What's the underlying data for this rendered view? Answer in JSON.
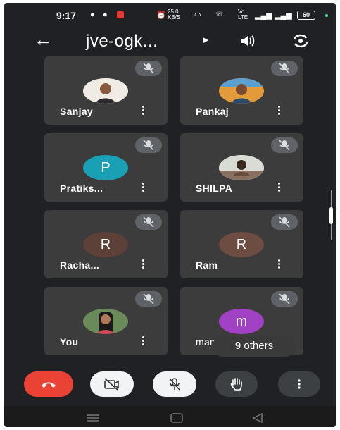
{
  "status_bar": {
    "time": "9:17",
    "net_speed": "25.0\nKB/S",
    "battery": "60",
    "signal_text": "Vo LTE"
  },
  "header": {
    "title": "jve-ogk...",
    "back_icon": "arrow-left-icon",
    "speaker_icon": "speaker-icon",
    "camera_switch_icon": "camera-switch-icon"
  },
  "participants": [
    {
      "name": "Sanjay",
      "avatar": "photo",
      "muted": true
    },
    {
      "name": "Pankaj",
      "avatar": "photo",
      "muted": true
    },
    {
      "name": "Pratiks...",
      "avatar_letter": "P",
      "avatar_color": "#1aa0b5",
      "muted": true
    },
    {
      "name": "SHILPA",
      "avatar": "photo",
      "muted": true
    },
    {
      "name": "Racha...",
      "avatar_letter": "R",
      "avatar_color": "#6d4c41",
      "muted": true
    },
    {
      "name": "Ram",
      "avatar_letter": "R",
      "avatar_color": "#7a5548",
      "muted": true
    },
    {
      "name": "You",
      "avatar": "photo",
      "muted": true
    },
    {
      "name": "man",
      "avatar_letter": "m",
      "avatar_color": "#a142c4",
      "muted": true
    }
  ],
  "others_chip": "9 others",
  "controls": {
    "end_call_color": "#ea4335",
    "items": [
      "end-call-icon",
      "camera-off-icon",
      "mic-off-icon",
      "raise-hand-icon",
      "more-vert-icon"
    ]
  },
  "nav": [
    "menu-icon",
    "home-icon",
    "back-icon"
  ]
}
